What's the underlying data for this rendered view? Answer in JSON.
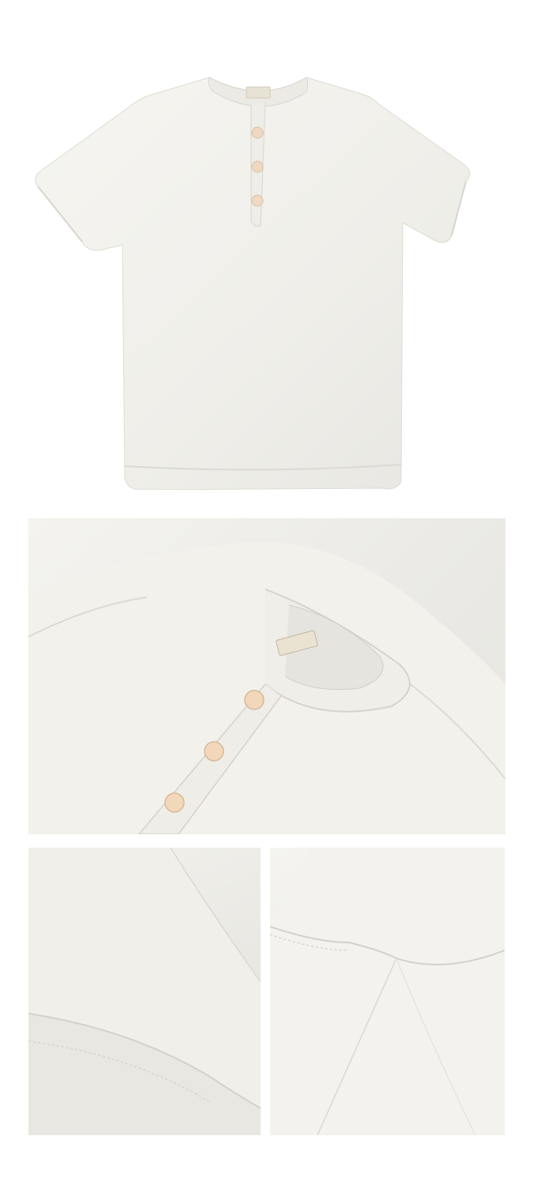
{
  "label": {
    "color_name": "白色"
  },
  "colors": {
    "shirt": "#f1f0eb",
    "shirt_shadow": "#e2e1dc",
    "button": "#f1d8bf",
    "background_panel": "#ebeae6"
  },
  "photos": [
    {
      "name": "hero-photo",
      "icon": "tshirt-front-flat-lay"
    },
    {
      "name": "collar-detail-photo",
      "icon": "collar-buttons-closeup"
    },
    {
      "name": "sleeve-hem-detail-photo",
      "icon": "sleeve-hem-closeup"
    },
    {
      "name": "underarm-seam-detail-photo",
      "icon": "underarm-seam-closeup"
    }
  ]
}
